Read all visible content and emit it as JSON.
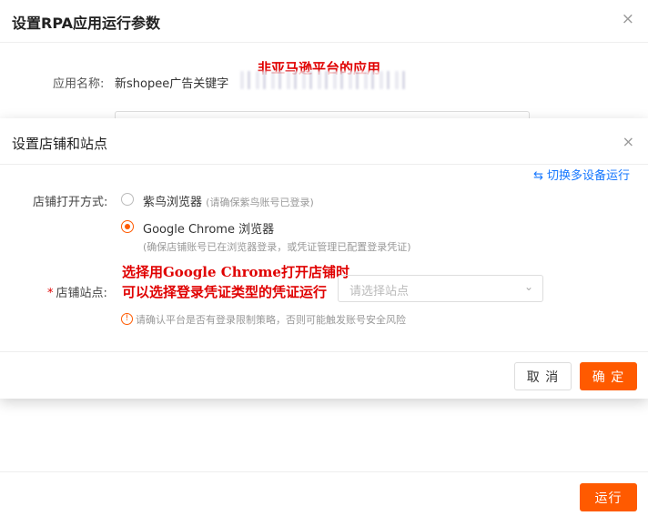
{
  "outer_modal": {
    "title": "设置RPA应用运行参数",
    "close_icon": "×",
    "app_name_label": "应用名称:",
    "app_name_value": "新shopee广告关键字",
    "run_label": "运行"
  },
  "inner_modal": {
    "title": "设置店铺和站点",
    "close_icon": "×",
    "switch_link": "切换多设备运行",
    "switch_icon": "⇆",
    "open_method_label": "店铺打开方式:",
    "options": [
      {
        "label": "紫鸟浏览器",
        "hint": "(请确保紫鸟账号已登录)",
        "selected": false
      },
      {
        "label": "Google Chrome 浏览器",
        "hint": "(确保店铺账号已在浏览器登录，或凭证管理已配置登录凭证)",
        "selected": true
      }
    ],
    "site_label": "店铺站点:",
    "required_mark": "*",
    "site_placeholder": "请选择站点",
    "warning": "请确认平台是否有登录限制策略，否则可能触发账号安全风险",
    "cancel_label": "取 消",
    "ok_label": "确 定"
  },
  "annotations": {
    "top": "非亚马逊平台的应用",
    "middle_line1": "选择用Google Chrome打开店铺时",
    "middle_line2": "可以选择登录凭证类型的凭证运行"
  },
  "colors": {
    "accent": "#ff5a00",
    "link": "#1677ff",
    "annotation": "#e00000"
  }
}
